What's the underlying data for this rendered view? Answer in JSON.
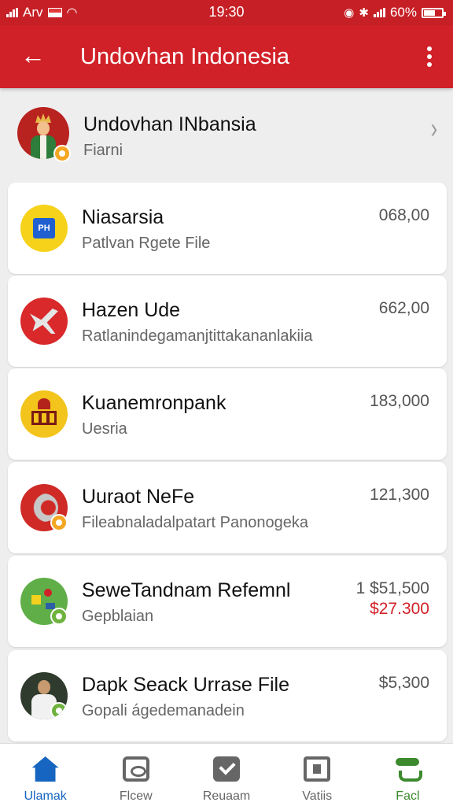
{
  "status_bar": {
    "carrier": "Arv",
    "time": "19:30",
    "battery": "60%",
    "battery_level": 0.6
  },
  "app_bar": {
    "back_icon": "arrow-left-icon",
    "title": "Undovhan Indonesia",
    "menu_icon": "more-vert-icon"
  },
  "profile": {
    "name": "Undovhan INbansia",
    "subtitle": "Fiarni",
    "chevron_icon": "chevron-right-icon"
  },
  "items": [
    {
      "title": "Niasarsia",
      "subtitle": "Patlvan Rgete File",
      "amount": "068,00",
      "icon": "wallet-card-icon",
      "icon_text": "PH"
    },
    {
      "title": "Hazen Ude",
      "subtitle": "Ratlanindegamanjtittakananlakiia",
      "amount": "662,00",
      "icon": "airplane-icon"
    },
    {
      "title": "Kuanemronpank",
      "subtitle": "Uesria",
      "amount": "183,000",
      "icon": "building-icon"
    },
    {
      "title": "Uuraot NeFe",
      "subtitle": "Fileabnaladalpatart Panonogeka",
      "amount": "121,300",
      "icon": "pipe-icon"
    },
    {
      "title": "SeweTandnam Refemnl",
      "subtitle": "Gepblaian",
      "amount": "1 $51,500",
      "amount_secondary": "$27.300",
      "icon": "shapes-icon"
    },
    {
      "title": "Dapk Seack Urrase File",
      "subtitle": "Gopali ágedemanadein",
      "amount": "$5,300",
      "icon": "person-photo-icon"
    }
  ],
  "bottom_nav": [
    {
      "label": "Ulamak",
      "icon": "home-icon"
    },
    {
      "label": "Flcew",
      "icon": "media-box-icon"
    },
    {
      "label": "Reuaam",
      "icon": "check-box-icon"
    },
    {
      "label": "Vatiis",
      "icon": "document-icon"
    },
    {
      "label": "Facl",
      "icon": "tray-icon"
    }
  ],
  "colors": {
    "brand_red": "#d12128",
    "active_blue": "#1665c0",
    "accent_green": "#3c8a2e",
    "negative_red": "#d12128"
  }
}
